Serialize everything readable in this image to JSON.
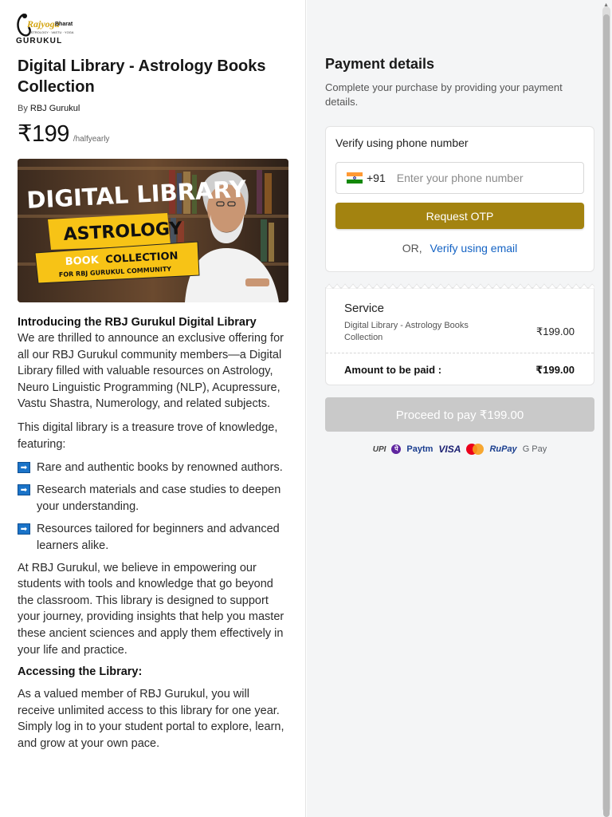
{
  "logo": {
    "brand": "Rajyoga Bharat",
    "name": "GURUKUL",
    "tagline": "ASTROLOGY · VASTU · YOGA"
  },
  "product": {
    "title": "Digital Library - Astrology Books Collection",
    "by_prefix": "By",
    "author": "RBJ Gurukul",
    "price": "₹199",
    "period": "/halfyearly"
  },
  "banner": {
    "line1": "DIGITAL LIBRARY",
    "line2": "ASTROLOGY",
    "line3a": "BOOK",
    "line3b": "COLLECTION",
    "line4": "FOR RBJ GURUKUL COMMUNITY"
  },
  "description": {
    "intro_heading": "Introducing the RBJ Gurukul Digital Library",
    "p1": "We are thrilled to announce an exclusive offering for all our RBJ Gurukul community members—a Digital Library filled with valuable resources on Astrology, Neuro Linguistic Programming (NLP), Acupressure, Vastu Shastra, Numerology, and related subjects.",
    "p2": "This digital library is a treasure trove of knowledge, featuring:",
    "features": [
      "Rare and authentic books by renowned authors.",
      "Research materials and case studies to deepen your understanding.",
      "Resources tailored for beginners and advanced learners alike."
    ],
    "p3": "At RBJ Gurukul, we believe in empowering our students with tools and knowledge that go beyond the classroom. This library is designed to support your journey, providing insights that help you master these ancient sciences and apply them effectively in your life and practice.",
    "access_heading": "Accessing the Library:",
    "p4": "As a valued member of RBJ Gurukul, you will receive unlimited access to this library for one year. Simply log in to your student portal to explore, learn, and grow at your own pace."
  },
  "payment": {
    "title": "Payment details",
    "subtitle": "Complete your purchase by providing your payment details.",
    "verify_title": "Verify using phone number",
    "country_code": "+91",
    "phone_placeholder": "Enter your phone number",
    "otp_button": "Request OTP",
    "or_text": "OR,",
    "email_link": "Verify using email",
    "service_label": "Service",
    "service_name": "Digital Library - Astrology Books Collection",
    "service_price": "₹199.00",
    "amount_label": "Amount to be paid :",
    "amount_value": "₹199.00",
    "proceed_button": "Proceed to pay ₹199.00",
    "methods": [
      "UPI",
      "PhonePe",
      "Paytm",
      "VISA",
      "Mastercard",
      "RuPay",
      "G Pay"
    ]
  },
  "colors": {
    "accent": "#a38310",
    "link": "#1463c4",
    "disabled": "#c9c9c9",
    "feature_icon": "#1a73c8"
  }
}
